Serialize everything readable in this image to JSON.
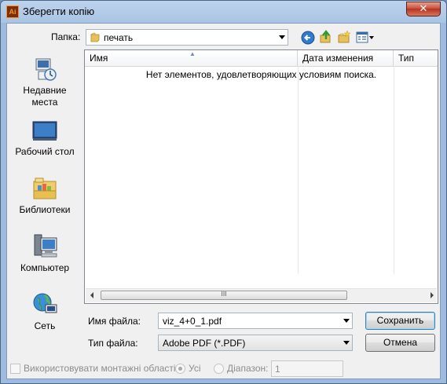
{
  "window": {
    "title": "Зберегти копію",
    "app_icon_text": "Ai",
    "close_symbol": "✕"
  },
  "location": {
    "label": "Папка:",
    "folder": "печать"
  },
  "toolbar": {
    "icons": [
      "back-icon",
      "up-folder-icon",
      "new-folder-icon",
      "view-menu-icon"
    ]
  },
  "places": [
    {
      "label": "Недавние места",
      "icon": "recent-places-icon"
    },
    {
      "label": "Рабочий стол",
      "icon": "desktop-icon"
    },
    {
      "label": "Библиотеки",
      "icon": "libraries-icon"
    },
    {
      "label": "Компьютер",
      "icon": "computer-icon"
    },
    {
      "label": "Сеть",
      "icon": "network-icon"
    }
  ],
  "file_list": {
    "columns": [
      "Имя",
      "Дата изменения",
      "Тип"
    ],
    "empty_message": "Нет элементов, удовлетворяющих условиям поиска.",
    "scroll_grip": "III"
  },
  "filename": {
    "label": "Имя файла:",
    "value": "viz_4+0_1.pdf"
  },
  "filetype": {
    "label": "Тип файла:",
    "value": "Adobe PDF (*.PDF)"
  },
  "buttons": {
    "save": "Сохранить",
    "cancel": "Отмена"
  },
  "options": {
    "artboards_label": "Використовувати монтажні області",
    "all_label": "Усі",
    "range_label": "Діапазон:",
    "range_value": "1"
  }
}
